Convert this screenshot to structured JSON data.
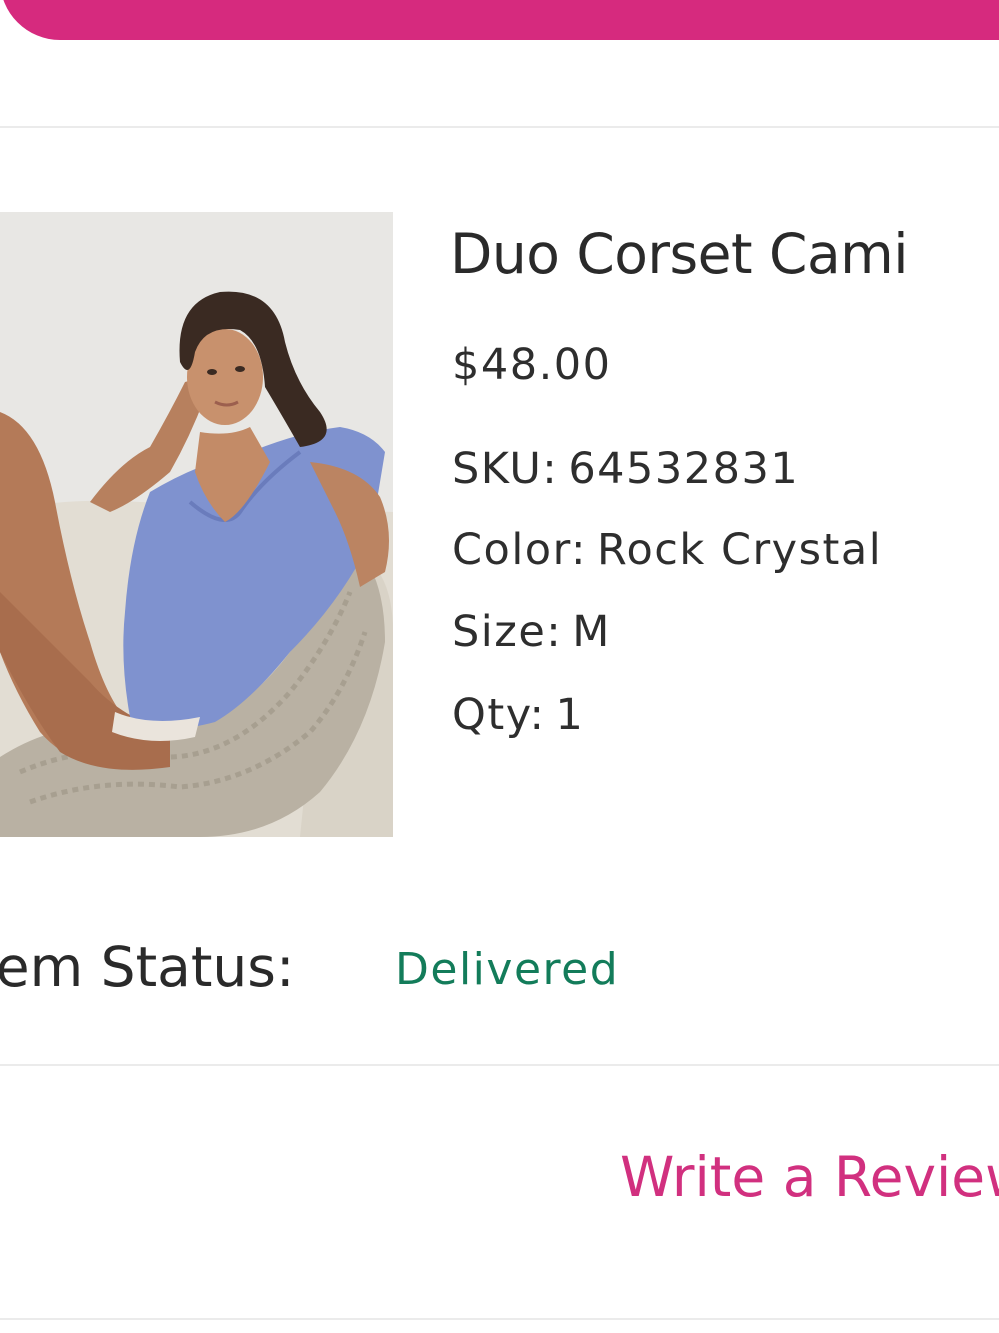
{
  "header": {
    "accent_color": "#d62a7e"
  },
  "item": {
    "image_alt": "Duo Corset Cami product photo",
    "name": "Duo Corset Cami",
    "price": "$48.00",
    "sku_label": "SKU:",
    "sku_value": "64532831",
    "color_label": "Color:",
    "color_value": "Rock Crystal",
    "size_label": "Size:",
    "size_value": "M",
    "qty_label": "Qty:",
    "qty_value": "1"
  },
  "status": {
    "label": "Item Status:",
    "value": "Delivered",
    "value_color": "#137c5a"
  },
  "actions": {
    "review_label": "Write a Review",
    "review_color": "#d1307f"
  }
}
